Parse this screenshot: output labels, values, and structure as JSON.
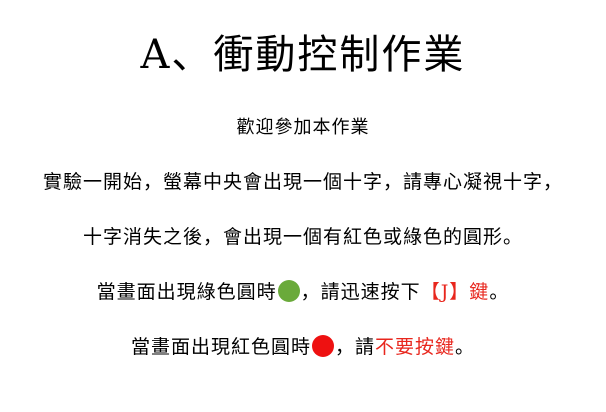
{
  "title": "A、衝動控制作業",
  "welcome": "歡迎參加本作業",
  "instructions": {
    "line1": "實驗一開始，螢幕中央會出現一個十字，請專心凝視十字，",
    "line2": "十字消失之後，會出現一個有紅色或綠色的圓形。",
    "line3": {
      "before": "當畫面出現綠色圓時",
      "after": "，請迅速按下",
      "key": "【J】鍵",
      "end": "。"
    },
    "line4": {
      "before": "當畫面出現紅色圓時",
      "after": "，請",
      "emphasis": "不要按鍵",
      "end": "。"
    }
  },
  "colors": {
    "green_circle": "#6aaa3a",
    "red_circle": "#ee1111",
    "accent_text": "#e8261d"
  }
}
